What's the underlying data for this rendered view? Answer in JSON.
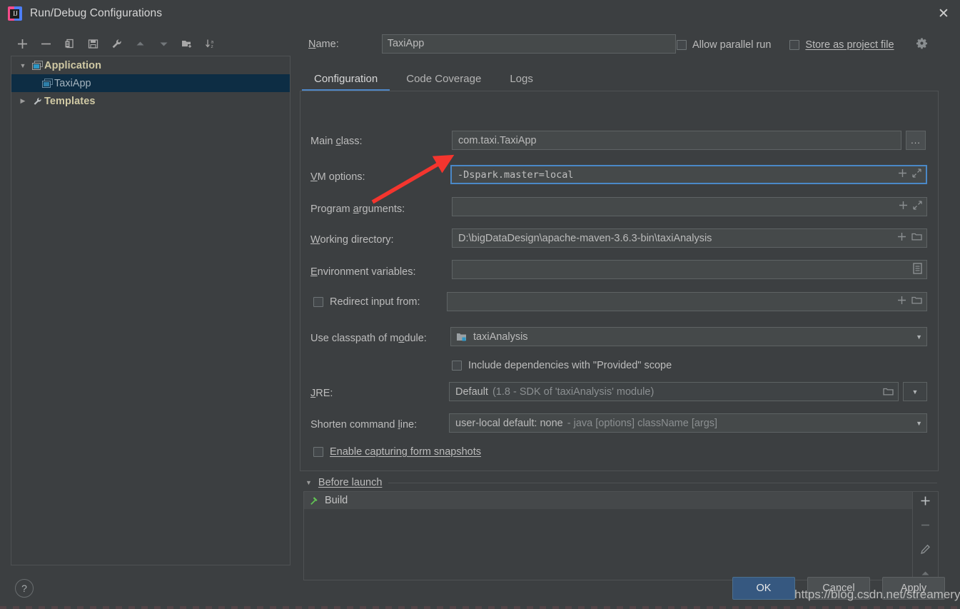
{
  "window": {
    "title": "Run/Debug Configurations",
    "app_icon": "intellij-idea-icon",
    "close_label": "✕"
  },
  "toolbar": {
    "buttons": [
      {
        "name": "add-configuration-button",
        "icon": "plus-icon",
        "label": "+"
      },
      {
        "name": "remove-configuration-button",
        "icon": "minus-icon",
        "label": "−"
      },
      {
        "name": "copy-configuration-button",
        "icon": "copy-icon",
        "label": "copy"
      },
      {
        "name": "save-configuration-button",
        "icon": "save-icon",
        "label": "save"
      },
      {
        "name": "edit-templates-button",
        "icon": "wrench-icon",
        "label": "wrench"
      },
      {
        "name": "move-up-button",
        "icon": "arrow-up-icon",
        "label": "up"
      },
      {
        "name": "move-down-button",
        "icon": "arrow-down-icon",
        "label": "down"
      },
      {
        "name": "new-folder-button",
        "icon": "folder-add-icon",
        "label": "new folder"
      },
      {
        "name": "sort-alphabetically-button",
        "icon": "sort-az-icon",
        "label": "sort a-z"
      }
    ]
  },
  "tree": {
    "items": [
      {
        "label": "Application",
        "type": "category",
        "twisty": "▼",
        "icon": "application-icon",
        "selected": false
      },
      {
        "label": "TaxiApp",
        "type": "item",
        "twisty": "",
        "icon": "application-icon",
        "selected": true
      },
      {
        "label": "Templates",
        "type": "category",
        "twisty": "▶",
        "icon": "wrench-icon",
        "selected": false
      }
    ]
  },
  "header": {
    "name_label": "Name:",
    "name_value": "TaxiApp",
    "allow_parallel_run_label": "Allow parallel run",
    "allow_parallel_run_checked": false,
    "store_as_project_file_label": "Store as project file",
    "store_as_project_file_checked": false,
    "gear_icon": "gear-dropdown-icon"
  },
  "tabs": [
    {
      "label": "Configuration",
      "active": true
    },
    {
      "label": "Code Coverage",
      "active": false
    },
    {
      "label": "Logs",
      "active": false
    }
  ],
  "form": {
    "main_class": {
      "label": "Main class:",
      "value": "com.taxi.TaxiApp",
      "browse_label": "..."
    },
    "vm_options": {
      "label": "VM options:",
      "value": "-Dspark.master=local",
      "focused": true,
      "macro_icon": "plus-icon",
      "expand_icon": "expand-icon"
    },
    "program_arguments": {
      "label": "Program arguments:",
      "value": "",
      "macro_icon": "plus-icon",
      "expand_icon": "expand-icon"
    },
    "working_directory": {
      "label": "Working directory:",
      "value": "D:\\bigDataDesign\\apache-maven-3.6.3-bin\\taxiAnalysis",
      "macro_icon": "plus-icon",
      "browse_icon": "folder-icon"
    },
    "environment_variables": {
      "label": "Environment variables:",
      "value": "",
      "browse_icon": "env-list-icon"
    },
    "redirect_input": {
      "label": "Redirect input from:",
      "checked": false,
      "value": "",
      "macro_icon": "plus-icon",
      "browse_icon": "folder-icon"
    },
    "classpath_module": {
      "label": "Use classpath of module:",
      "value": "taxiAnalysis",
      "icon": "module-icon",
      "arrow": "▼"
    },
    "include_provided": {
      "label": "Include dependencies with \"Provided\" scope",
      "checked": false
    },
    "jre": {
      "label": "JRE:",
      "value": "Default",
      "hint": "(1.8 - SDK of 'taxiAnalysis' module)",
      "browse_icon": "folder-icon",
      "arrow": "▼"
    },
    "shorten_command_line": {
      "label": "Shorten command line:",
      "value": "user-local default: none",
      "hint": "- java [options] className [args]",
      "arrow": "▼"
    },
    "form_snapshots": {
      "label": "Enable capturing form snapshots",
      "checked": false
    }
  },
  "before_launch": {
    "title": "Before launch",
    "twisty": "▼",
    "items": [
      {
        "label": "Build",
        "icon": "build-hammer-icon"
      }
    ],
    "side_buttons": [
      {
        "name": "add-task-button",
        "icon": "plus-icon",
        "label": "+"
      },
      {
        "name": "remove-task-button",
        "icon": "minus-icon",
        "label": "−"
      },
      {
        "name": "edit-task-button",
        "icon": "pencil-icon",
        "label": "edit"
      },
      {
        "name": "move-task-up-button",
        "icon": "arrow-up-icon",
        "label": "up"
      }
    ]
  },
  "footer": {
    "help_label": "?",
    "ok_label": "OK",
    "cancel_label": "Cancel",
    "apply_label": "Apply"
  },
  "watermark": {
    "text": "https://blog.csdn.net/streamery"
  },
  "colors": {
    "background": "#3c3f41",
    "field_background": "#45494a",
    "accent_blue": "#4e87c7",
    "selection": "#0d2d44",
    "primary_button": "#365880",
    "category_text": "#d0c9a4",
    "annotation_red": "#f4352e"
  }
}
